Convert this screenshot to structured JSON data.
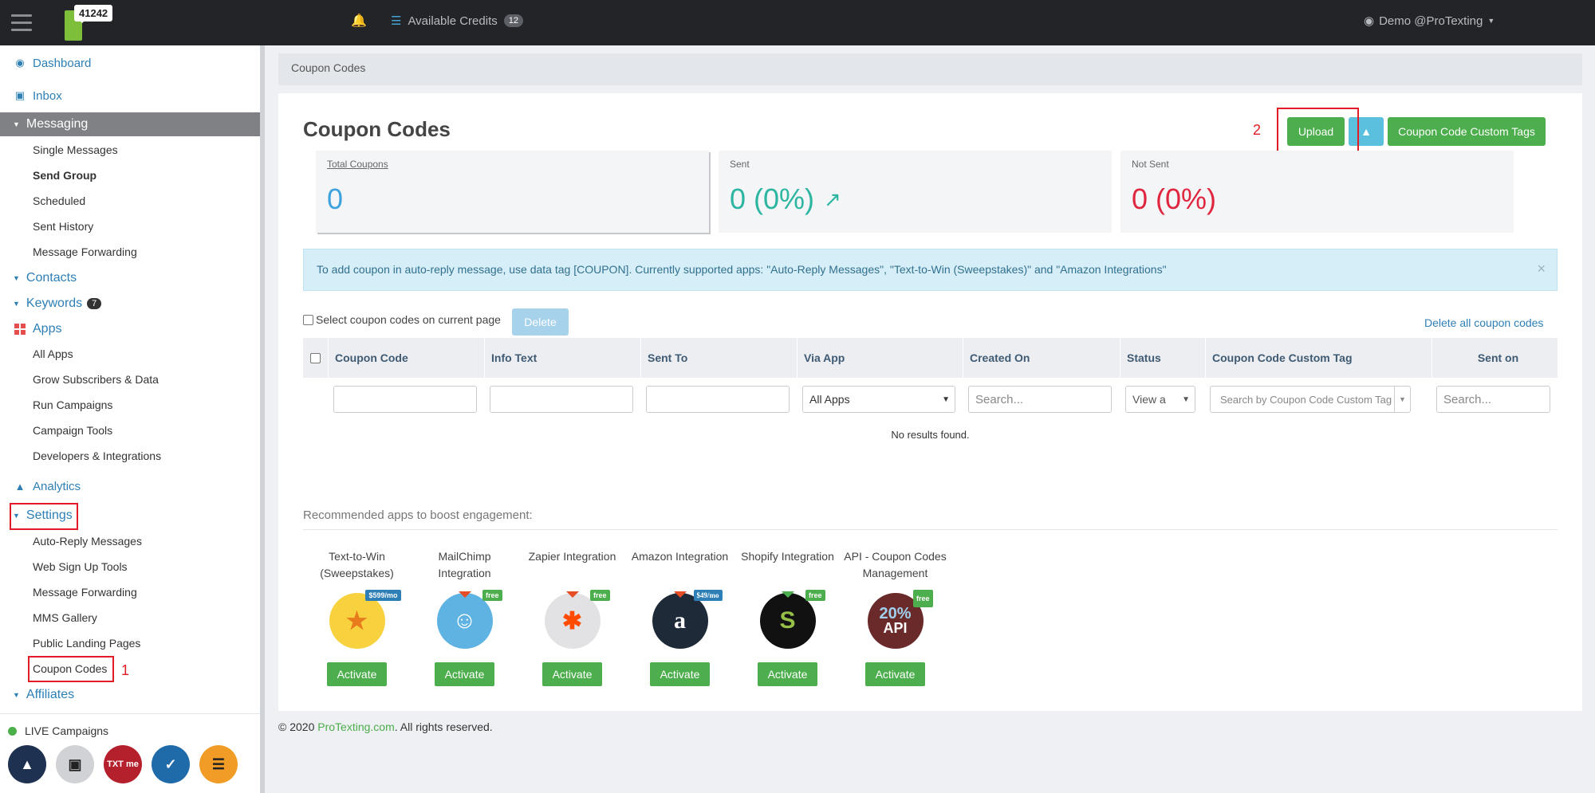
{
  "topbar": {
    "logo_count": "41242",
    "credits_label": "Available Credits",
    "credits_count": "12",
    "user": "Demo @ProTexting"
  },
  "sidebar": {
    "top_items": [
      {
        "label": "Dashboard",
        "icon": "dashboard-icon"
      },
      {
        "label": "Inbox",
        "icon": "inbox-icon"
      }
    ],
    "messaging": {
      "label": "Messaging",
      "items": [
        "Single Messages",
        "Send Group",
        "Scheduled",
        "Sent History",
        "Message Forwarding"
      ]
    },
    "contacts": "Contacts",
    "keywords": "Keywords",
    "keywords_badge": "7",
    "apps": {
      "label": "Apps",
      "items": [
        "All Apps",
        "Grow Subscribers & Data",
        "Run Campaigns",
        "Campaign Tools",
        "Developers & Integrations"
      ]
    },
    "analytics": "Analytics",
    "settings": {
      "label": "Settings",
      "items": [
        "Auto-Reply Messages",
        "Web Sign Up Tools",
        "Message Forwarding",
        "MMS Gallery",
        "Public Landing Pages",
        "Coupon Codes"
      ]
    },
    "affiliates": "Affiliates",
    "live_campaigns": "LIVE Campaigns",
    "quick_icons": [
      "thumbs-up-icon",
      "contact-card-icon",
      "txt-me-icon",
      "checklist-icon",
      "list-icon"
    ],
    "quick_txt": "TXT me"
  },
  "annotations": {
    "one": "1",
    "two": "2"
  },
  "breadcrumb": "Coupon Codes",
  "page_title": "Coupon Codes",
  "buttons": {
    "upload": "Upload",
    "custom_tags": "Coupon Code Custom Tags",
    "delete": "Delete",
    "delete_all": "Delete all coupon codes"
  },
  "stats": [
    {
      "label": "Total Coupons",
      "value": "0",
      "color": "#3ea3dc"
    },
    {
      "label": "Sent",
      "value": "0 (0%)",
      "color": "#2cb5a0"
    },
    {
      "label": "Not Sent",
      "value": "0 (0%)",
      "color": "#e0263f"
    }
  ],
  "alert": "To add coupon in auto-reply message, use data tag [COUPON]. Currently supported apps: \"Auto-Reply Messages\", \"Text-to-Win (Sweepstakes)\" and \"Amazon Integrations\"",
  "select_label": "Select coupon codes on current page",
  "table": {
    "columns": [
      "Coupon Code",
      "Info Text",
      "Sent To",
      "Via App",
      "Created On",
      "Status",
      "Coupon Code Custom Tag",
      "Sent on"
    ],
    "filters": {
      "via_app": "All Apps",
      "created_on_placeholder": "Search...",
      "status": "View a",
      "custom_tag_placeholder": "Search by Coupon Code Custom Tag",
      "sent_on_placeholder": "Search..."
    },
    "empty": "No results found."
  },
  "recommended": {
    "title": "Recommended apps to boost engagement:",
    "apps": [
      {
        "name": "Text-to-Win (Sweepstakes)",
        "tag": "$599/mo",
        "icon": "trophy-icon"
      },
      {
        "name": "MailChimp Integration",
        "tag": "free",
        "icon": "mailchimp-icon"
      },
      {
        "name": "Zapier Integration",
        "tag": "free",
        "icon": "zapier-icon"
      },
      {
        "name": "Amazon Integration",
        "tag": "$49/mo",
        "icon": "amazon-icon"
      },
      {
        "name": "Shopify Integration",
        "tag": "free",
        "icon": "shopify-icon"
      },
      {
        "name": "API - Coupon Codes Management",
        "tag": "free",
        "icon": "api-icon"
      }
    ],
    "activate": "Activate",
    "api_icon_top": "20%",
    "api_icon_bottom": "API"
  },
  "footer": {
    "prefix": "© 2020 ",
    "link": "ProTexting.com",
    "suffix": ". All rights reserved."
  }
}
